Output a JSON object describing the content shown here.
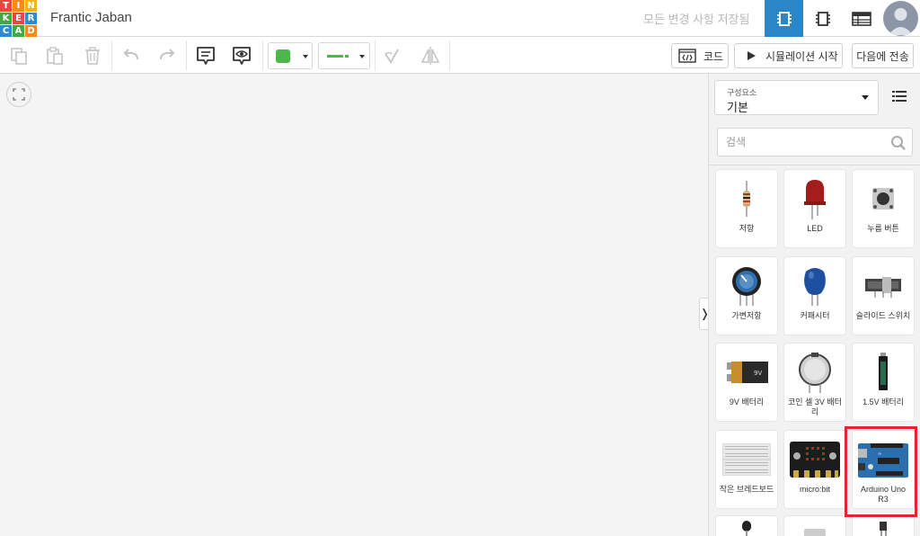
{
  "logo": {
    "letters": [
      "T",
      "I",
      "N",
      "K",
      "E",
      "R",
      "C",
      "A",
      "D"
    ],
    "colors": [
      "#e8473d",
      "#f58a1f",
      "#f2b41b",
      "#42a846",
      "#e8473d",
      "#2f8ad0",
      "#2f8ad0",
      "#42a846",
      "#f58a1f"
    ]
  },
  "header": {
    "project_title": "Frantic Jaban",
    "save_status": "모든 변경 사항 저장됨",
    "views": [
      "circuit-view-icon",
      "schematic-view-icon",
      "component-list-icon"
    ]
  },
  "toolbar": {
    "code_label": "코드",
    "simulate_label": "시뮬레이션 시작",
    "send_label": "다음에 전송",
    "fill_color": "#4cb848",
    "wire_color": "#4cb848"
  },
  "panel": {
    "category_label": "구성요소",
    "category_value": "기본",
    "search_placeholder": "검색",
    "components": [
      {
        "label": "저항",
        "icon": "resistor"
      },
      {
        "label": "LED",
        "icon": "led"
      },
      {
        "label": "누름 버튼",
        "icon": "pushbutton"
      },
      {
        "label": "가변저항",
        "icon": "potentiometer"
      },
      {
        "label": "커패시터",
        "icon": "capacitor"
      },
      {
        "label": "슬라이드 스위치",
        "icon": "slide-switch"
      },
      {
        "label": "9V 배터리",
        "icon": "battery-9v"
      },
      {
        "label": "코인 셀 3V 배터리",
        "icon": "coin-cell"
      },
      {
        "label": "1.5V 배터리",
        "icon": "battery-aa"
      },
      {
        "label": "작은 브레드보드",
        "icon": "breadboard"
      },
      {
        "label": "micro:bit",
        "icon": "microbit"
      },
      {
        "label": "Arduino Uno R3",
        "icon": "arduino-uno"
      }
    ],
    "highlight_color": "#e8232b"
  },
  "colors": {
    "accent": "#2b86c8"
  }
}
